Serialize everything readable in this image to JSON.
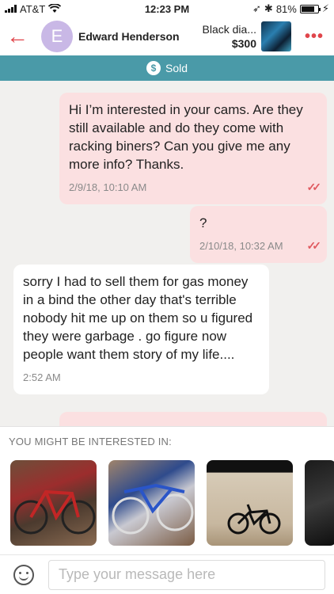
{
  "status_bar": {
    "carrier": "AT&T",
    "time": "12:23 PM",
    "battery": "81%",
    "battery_level": 0.81
  },
  "header": {
    "back_icon": "arrow-left-icon",
    "avatar_initial": "E",
    "user_name": "Edward Henderson",
    "listing_title": "Black dia...",
    "listing_price": "$300",
    "more_icon": "ellipsis-icon",
    "accent_color": "#e0454b"
  },
  "banner": {
    "icon": "$",
    "label": "Sold",
    "color": "#4a9aa8"
  },
  "messages": [
    {
      "direction": "outgoing",
      "text": "Hi I’m interested in your cams. Are they still available and do they come with racking biners? Can you give me any more info? Thanks.",
      "time": "2/9/18, 10:10 AM"
    },
    {
      "direction": "outgoing",
      "text": "?",
      "time": "2/10/18, 10:32 AM"
    },
    {
      "direction": "incoming",
      "text": "sorry I had to sell them for gas money in a bind the other day that's terrible nobody hit me up on them so u figured they were garbage . go figure now people want them story of my life....",
      "time": "2:52 AM"
    }
  ],
  "suggestions": {
    "title": "YOU MIGHT BE INTERESTED IN:",
    "items": [
      "red-bicycle-photo",
      "bicycles-stack-photo",
      "bmx-bicycle-photo",
      "bicycle-photo"
    ]
  },
  "composer": {
    "placeholder": "Type your message here",
    "emoji_icon": "smiley-icon"
  }
}
